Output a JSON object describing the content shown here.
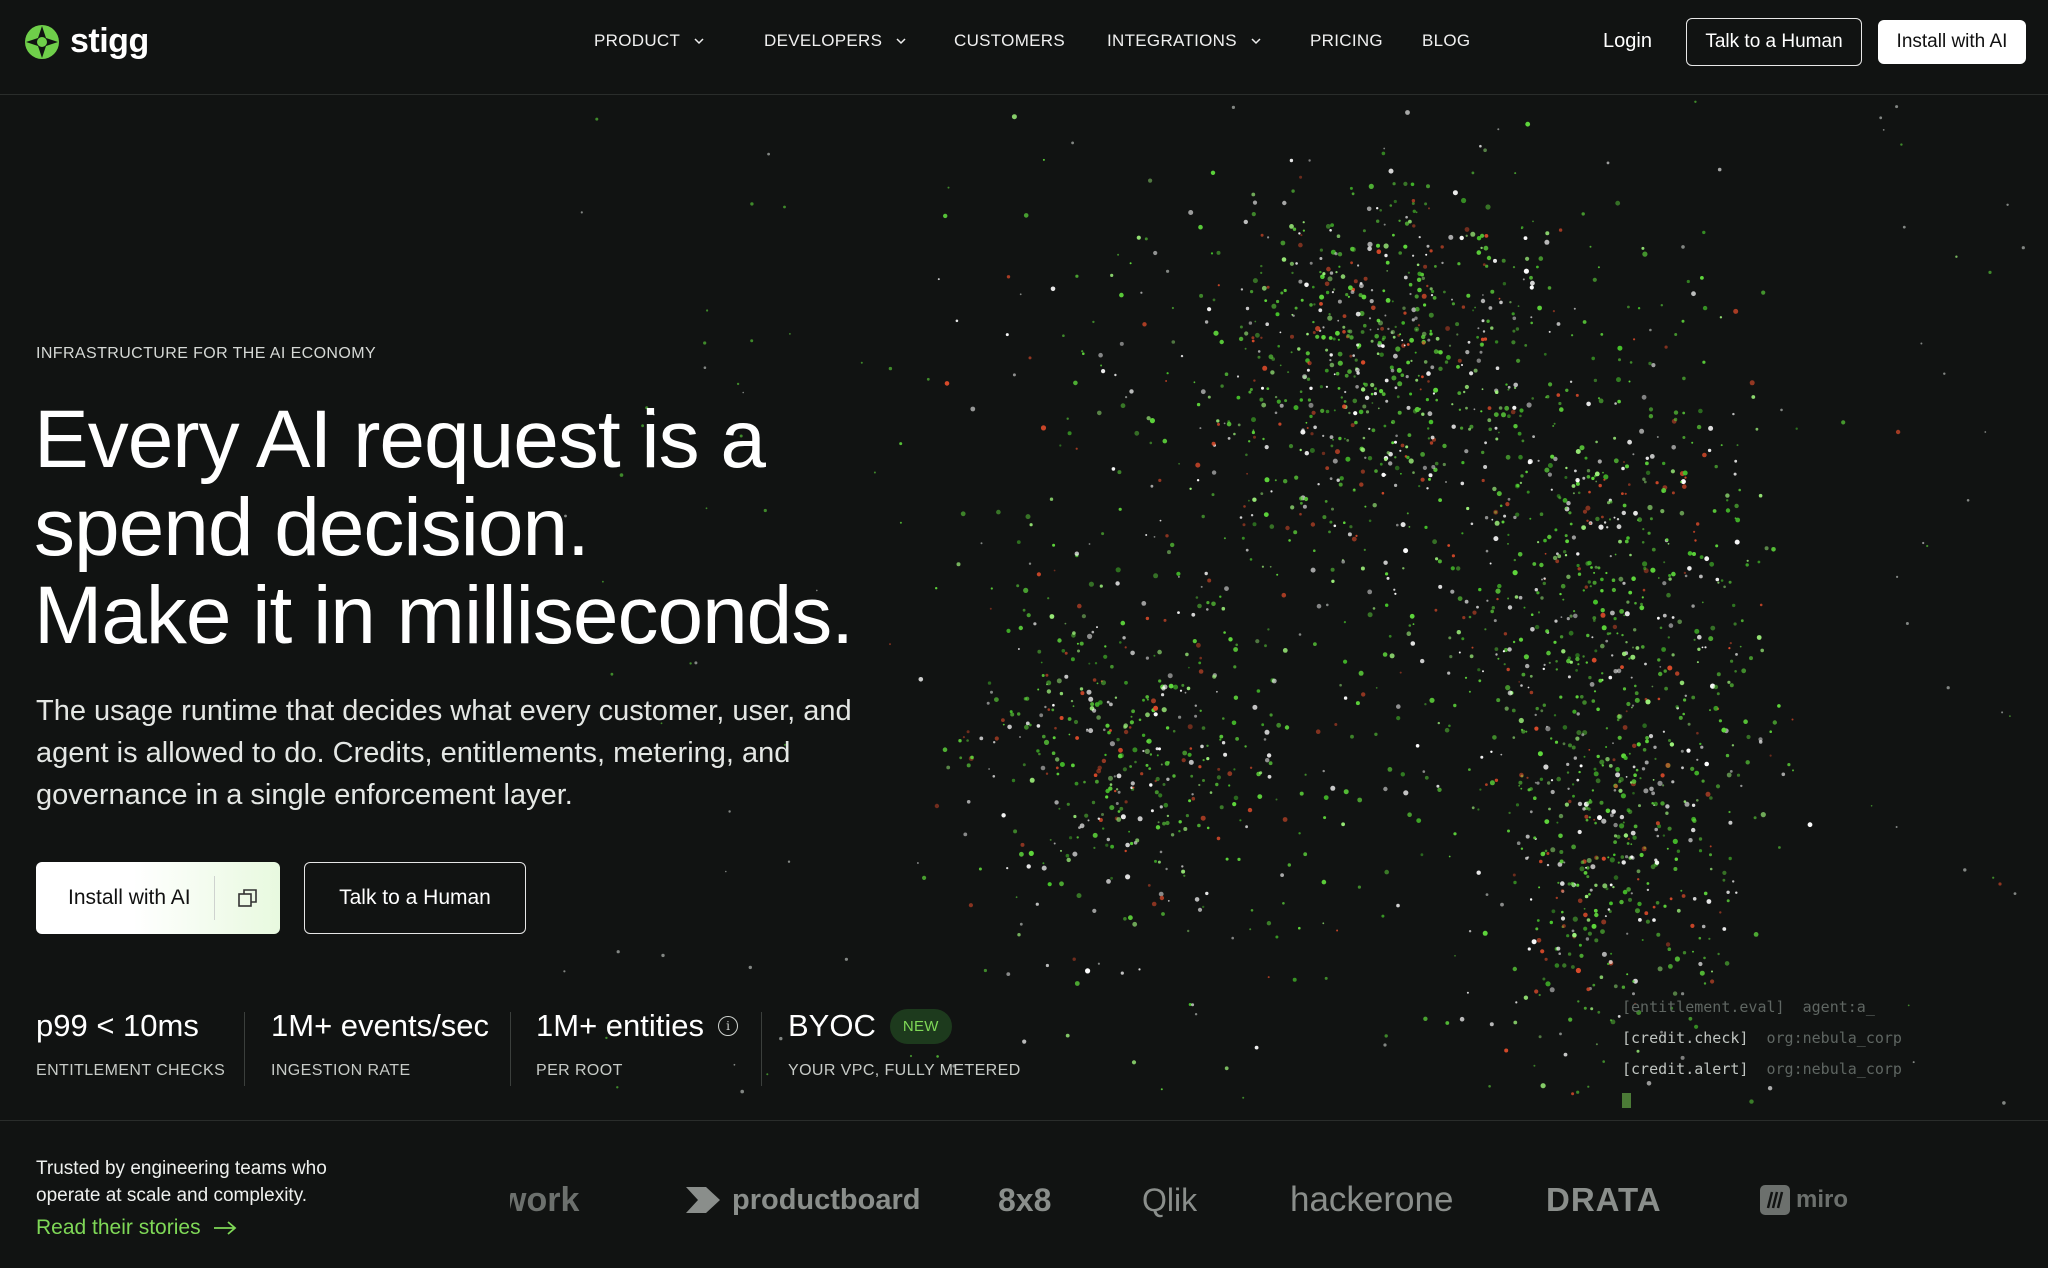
{
  "brand": {
    "name": "stigg",
    "accent": "#7fd857",
    "background": "#111312"
  },
  "nav": {
    "items": [
      {
        "label": "PRODUCT",
        "has_dropdown": true
      },
      {
        "label": "DEVELOPERS",
        "has_dropdown": true
      },
      {
        "label": "CUSTOMERS",
        "has_dropdown": false
      },
      {
        "label": "INTEGRATIONS",
        "has_dropdown": true
      },
      {
        "label": "PRICING",
        "has_dropdown": false
      },
      {
        "label": "BLOG",
        "has_dropdown": false
      }
    ],
    "login": "Login",
    "talk_button": "Talk to a Human",
    "install_button": "Install with AI"
  },
  "hero": {
    "kicker": "INFRASTRUCTURE FOR THE AI ECONOMY",
    "headline_1": "Every AI request is a",
    "headline_2": "spend decision.",
    "headline_3": "Make it in milliseconds.",
    "subtitle": "The usage runtime that decides what every customer, user, and agent is allowed to do. Credits, entitlements, metering, and governance in a single enforcement layer.",
    "cta_primary": "Install with AI",
    "cta_secondary": "Talk to a Human"
  },
  "stats": [
    {
      "value": "p99 < 10ms",
      "label": "ENTITLEMENT CHECKS"
    },
    {
      "value": "1M+ events/sec",
      "label": "INGESTION RATE"
    },
    {
      "value": "1M+ entities",
      "label": "PER ROOT",
      "info_icon": true
    },
    {
      "value": "BYOC",
      "label": "YOUR VPC, FULLY METERED",
      "badge": "NEW"
    }
  ],
  "terminal": {
    "lines": [
      {
        "event": "[entitlement.eval]",
        "detail": "agent:a_"
      },
      {
        "event": "[credit.check]",
        "detail": "org:nebula_corp"
      },
      {
        "event": "[credit.alert]",
        "detail": "org:nebula_corp"
      }
    ]
  },
  "trusted": {
    "text": "Trusted by engineering teams who operate at scale and complexity.",
    "link": "Read their stories"
  },
  "logos": [
    "work",
    "productboard",
    "8x8",
    "Qlik",
    "hackerone",
    "DRATA",
    "miro"
  ]
}
